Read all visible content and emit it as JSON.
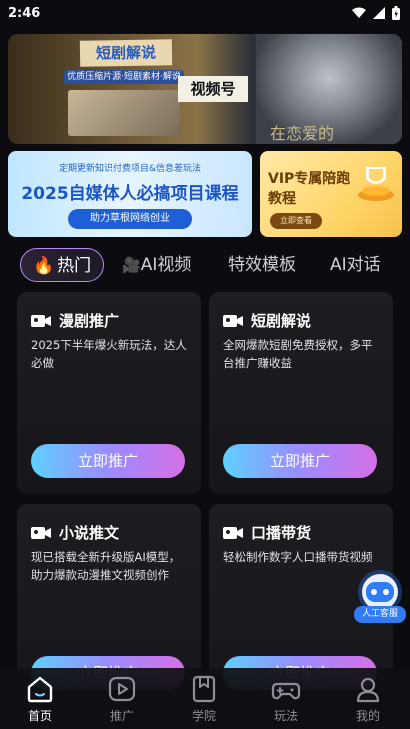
{
  "status": {
    "time": "2:46"
  },
  "banner": {
    "left_title": "短剧解说",
    "left_subtitle": "优质压缩片源·短剧素材·解说",
    "mid_title": "视频号",
    "right_text": "在恋爱的"
  },
  "promo_left": {
    "top_text": "定期更新知识付费项目&信息差玩法",
    "main_text": "2025自媒体人必搞项目课程",
    "button": "助力草根网络创业"
  },
  "promo_right": {
    "title": "VIP专属陪跑教程",
    "button": "立即查看"
  },
  "tabs": [
    {
      "label": "热门",
      "icon": "fire-icon"
    },
    {
      "label": "AI视频",
      "icon": "camera-icon"
    },
    {
      "label": "特效模板"
    },
    {
      "label": "AI对话"
    }
  ],
  "cards": [
    {
      "title": "漫剧推广",
      "desc": "2025下半年爆火新玩法，达人必做",
      "button": "立即推广"
    },
    {
      "title": "短剧解说",
      "desc": "全网爆款短剧免费授权，多平台推广赚收益",
      "button": "立即推广"
    },
    {
      "title": "小说推文",
      "desc": "现已搭载全新升级版AI模型，助力爆款动漫推文视频创作",
      "button": "立即推广"
    },
    {
      "title": "口播带货",
      "desc": "轻松制作数字人口播带货视频",
      "button": "立即推广"
    }
  ],
  "customer_service": {
    "label": "人工客服"
  },
  "tabbar": [
    {
      "label": "首页",
      "icon": "home-icon"
    },
    {
      "label": "推广",
      "icon": "play-icon"
    },
    {
      "label": "学院",
      "icon": "bookmark-icon"
    },
    {
      "label": "玩法",
      "icon": "gamepad-icon"
    },
    {
      "label": "我的",
      "icon": "user-icon"
    }
  ],
  "colors": {
    "accent_gradient": [
      "#5fd0ff",
      "#9a8cff",
      "#d66fe6"
    ],
    "active_tab_border": "#b98cf0",
    "background": "#0c0c10"
  }
}
